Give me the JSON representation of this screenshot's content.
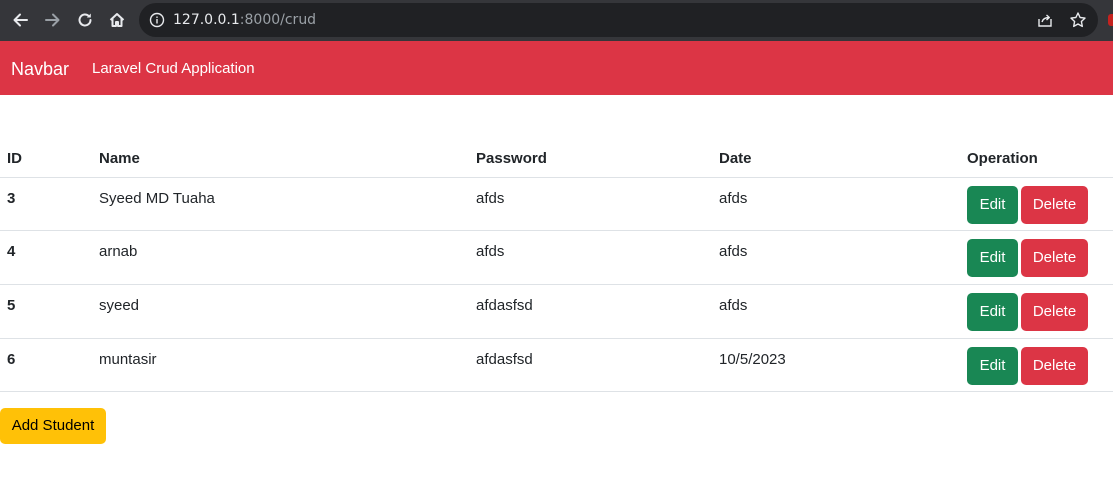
{
  "browser": {
    "url_host": "127.0.0.1",
    "url_rest": ":8000/crud"
  },
  "navbar": {
    "brand": "Navbar",
    "link": "Laravel Crud Application",
    "color": "#dc3545"
  },
  "table": {
    "headers": [
      "ID",
      "Name",
      "Password",
      "Date",
      "Operation"
    ],
    "rows": [
      {
        "id": "3",
        "name": "Syeed MD Tuaha",
        "password": "afds",
        "date": "afds"
      },
      {
        "id": "4",
        "name": "arnab",
        "password": "afds",
        "date": "afds"
      },
      {
        "id": "5",
        "name": "syeed",
        "password": "afdasfsd",
        "date": "afds"
      },
      {
        "id": "6",
        "name": "muntasir",
        "password": "afdasfsd",
        "date": "10/5/2023"
      }
    ],
    "edit_label": "Edit",
    "delete_label": "Delete"
  },
  "add_student_label": "Add Student",
  "colors": {
    "edit": "#198754",
    "delete": "#dc3545",
    "add": "#ffc107"
  },
  "icons": [
    "back-arrow-icon",
    "forward-arrow-icon",
    "reload-icon",
    "home-icon",
    "info-icon",
    "share-icon",
    "star-icon"
  ]
}
